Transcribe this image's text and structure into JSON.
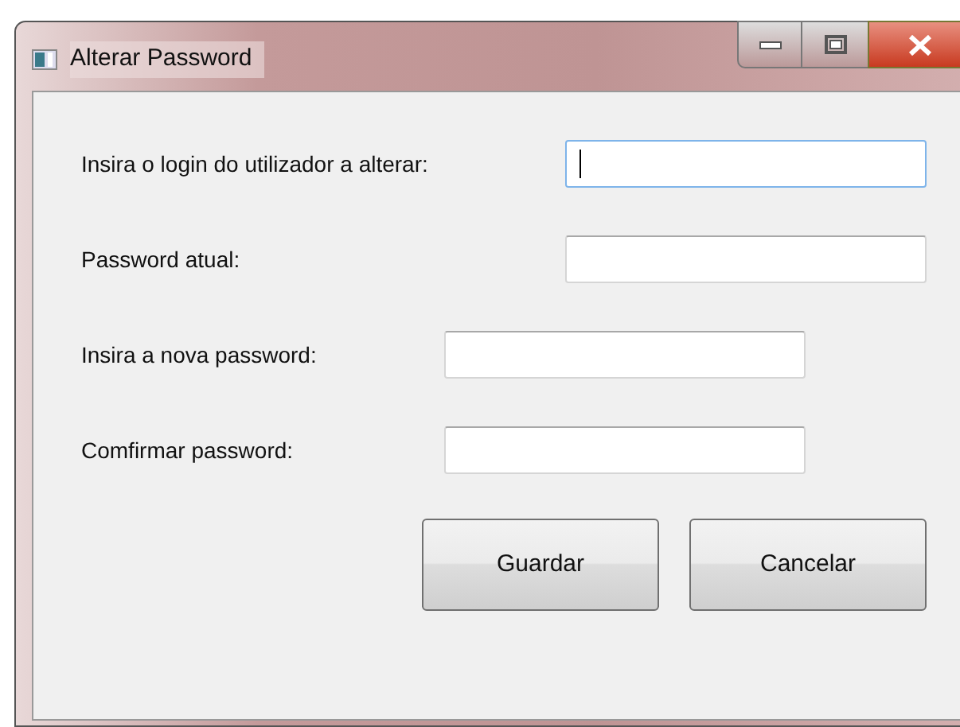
{
  "window": {
    "title": "Alterar Password"
  },
  "fields": [
    {
      "label": "Insira o login do utilizador a alterar:",
      "focused": true
    },
    {
      "label": "Password atual:",
      "focused": false
    },
    {
      "label": "Insira a nova password:",
      "focused": false
    },
    {
      "label": "Comfirmar password:",
      "focused": false
    }
  ],
  "buttons": [
    "Guardar",
    "Cancelar"
  ]
}
